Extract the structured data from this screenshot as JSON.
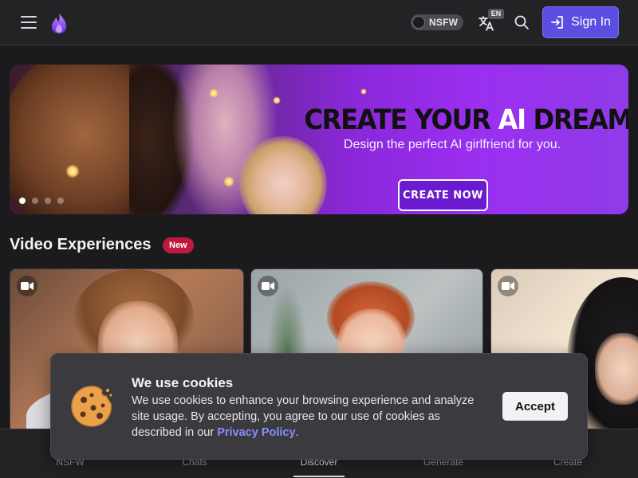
{
  "header": {
    "nsfw_label": "NSFW",
    "lang_badge": "EN",
    "signin_label": "Sign In",
    "icons": [
      "menu-icon",
      "flame-logo-icon",
      "translate-icon",
      "search-icon",
      "sign-in-icon"
    ]
  },
  "banner": {
    "title_part1": "CREATE YOUR ",
    "title_ai": "AI",
    "title_part2": " DREAM GIRL",
    "subtitle": "Design the perfect AI girlfriend for you.",
    "cta_label": "CREATE NOW",
    "slide_count": 4,
    "active_slide": 1
  },
  "section": {
    "title": "Video Experiences",
    "badge": "New"
  },
  "cards": [
    {
      "icon": "video-camera-icon"
    },
    {
      "icon": "video-camera-icon"
    },
    {
      "icon": "video-camera-icon"
    }
  ],
  "bottom_nav": {
    "items": [
      {
        "label": "NSFW"
      },
      {
        "label": "Chats"
      },
      {
        "label": "Discover"
      },
      {
        "label": "Generate"
      },
      {
        "label": "Create"
      }
    ],
    "active": "Discover"
  },
  "cookie": {
    "title": "We use cookies",
    "text": "We use cookies to enhance your browsing experience and analyze site usage. By accepting, you agree to our use of cookies as described in our ",
    "link": "Privacy Policy",
    "text_end": ".",
    "accept_label": "Accept"
  },
  "colors": {
    "accent": "#5b4ee0",
    "badge_red": "#c0193f",
    "banner_purple": "#9b2ff0",
    "link": "#8a8dff"
  }
}
